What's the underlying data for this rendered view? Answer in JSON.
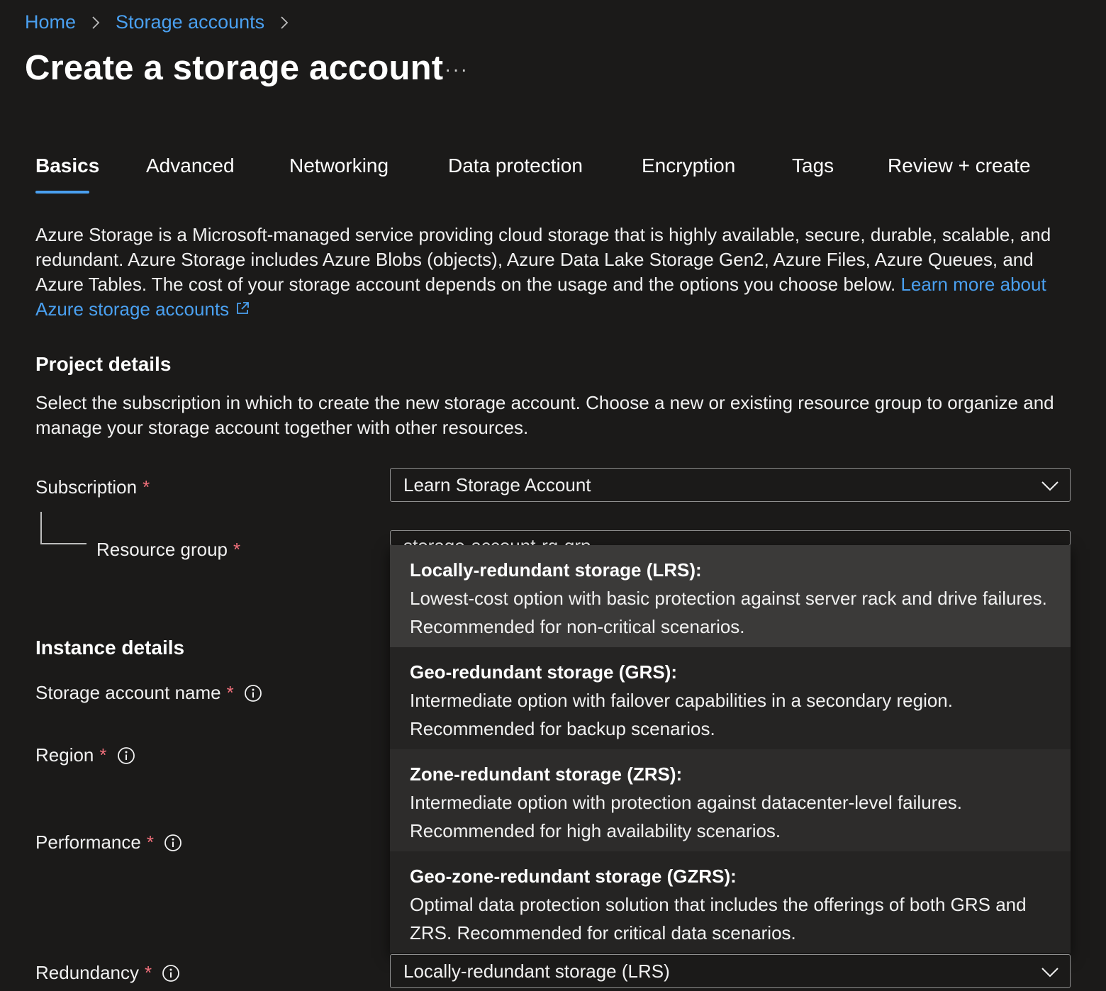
{
  "breadcrumb": {
    "home": "Home",
    "storage_accounts": "Storage accounts"
  },
  "page": {
    "title": "Create a storage account",
    "more": "···"
  },
  "tabs": [
    {
      "label": "Basics",
      "active": true
    },
    {
      "label": "Advanced"
    },
    {
      "label": "Networking"
    },
    {
      "label": "Data protection"
    },
    {
      "label": "Encryption"
    },
    {
      "label": "Tags"
    },
    {
      "label": "Review + create"
    }
  ],
  "intro": {
    "text": "Azure Storage is a Microsoft-managed service providing cloud storage that is highly available, secure, durable, scalable, and redundant. Azure Storage includes Azure Blobs (objects), Azure Data Lake Storage Gen2, Azure Files, Azure Queues, and Azure Tables. The cost of your storage account depends on the usage and the options you choose below.",
    "link": "Learn more about Azure storage accounts"
  },
  "project": {
    "title": "Project details",
    "description": "Select the subscription in which to create the new storage account. Choose a new or existing resource group to organize and manage your storage account together with other resources.",
    "subscription_label": "Subscription",
    "subscription_value": "Learn Storage Account",
    "resource_group_label": "Resource group",
    "resource_group_value": "storage-account-rg-grp"
  },
  "instance": {
    "title": "Instance details",
    "name_label": "Storage account name",
    "region_label": "Region",
    "performance_label": "Performance",
    "redundancy_label": "Redundancy",
    "redundancy_value": "Locally-redundant storage (LRS)"
  },
  "required_marker": "*",
  "redundancy_options": [
    {
      "title": "Locally-redundant storage (LRS):",
      "line1": "Lowest-cost option with basic protection against server rack and drive failures.",
      "line2": "Recommended for non-critical scenarios.",
      "selected": true
    },
    {
      "title": "Geo-redundant storage (GRS):",
      "line1": "Intermediate option with failover capabilities in a secondary region.",
      "line2": "Recommended for backup scenarios."
    },
    {
      "title": "Zone-redundant storage (ZRS):",
      "line1": "Intermediate option with protection against datacenter-level failures.",
      "line2": "Recommended for high availability scenarios."
    },
    {
      "title": "Geo-zone-redundant storage (GZRS):",
      "line1": "Optimal data protection solution that includes the offerings of both GRS and",
      "line2": "ZRS. Recommended for critical data scenarios."
    }
  ],
  "colors": {
    "background": "#1b1a19",
    "accent": "#4aa0f0",
    "required": "#f1707b",
    "dropdown": "#252423",
    "selected_option": "#3b3a39"
  },
  "icons": [
    "chevron-right-icon",
    "external-link-icon",
    "info-icon",
    "chevron-down-icon"
  ]
}
